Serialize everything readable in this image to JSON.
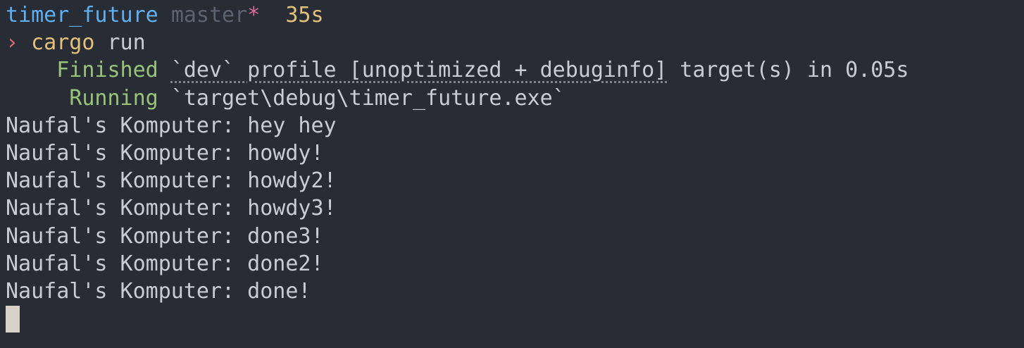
{
  "prompt": {
    "directory": "timer_future",
    "branch": "master",
    "dirty_marker": "*",
    "duration": "35s",
    "symbol": "›"
  },
  "command": {
    "program": "cargo",
    "args": "run"
  },
  "build": {
    "finished_label": "Finished",
    "finished_profile": "`dev` profile [unoptimized + debuginfo]",
    "finished_rest": "target(s) in 0.05s",
    "running_label": "Running",
    "running_path": "`target\\debug\\timer_future.exe`"
  },
  "output_lines": [
    "Naufal's Komputer: hey hey",
    "Naufal's Komputer: howdy!",
    "Naufal's Komputer: howdy2!",
    "Naufal's Komputer: howdy3!",
    "Naufal's Komputer: done3!",
    "Naufal's Komputer: done2!",
    "Naufal's Komputer: done!"
  ],
  "colors": {
    "background": "#282c34",
    "foreground": "#c8ccd4",
    "directory": "#61afef",
    "branch": "#5c6370",
    "dirty": "#e06c9f",
    "duration": "#e5c07b",
    "prompt_symbol": "#e06c75",
    "command": "#e5c07b",
    "cargo_status": "#98c379",
    "cursor": "#d8d2c8"
  }
}
